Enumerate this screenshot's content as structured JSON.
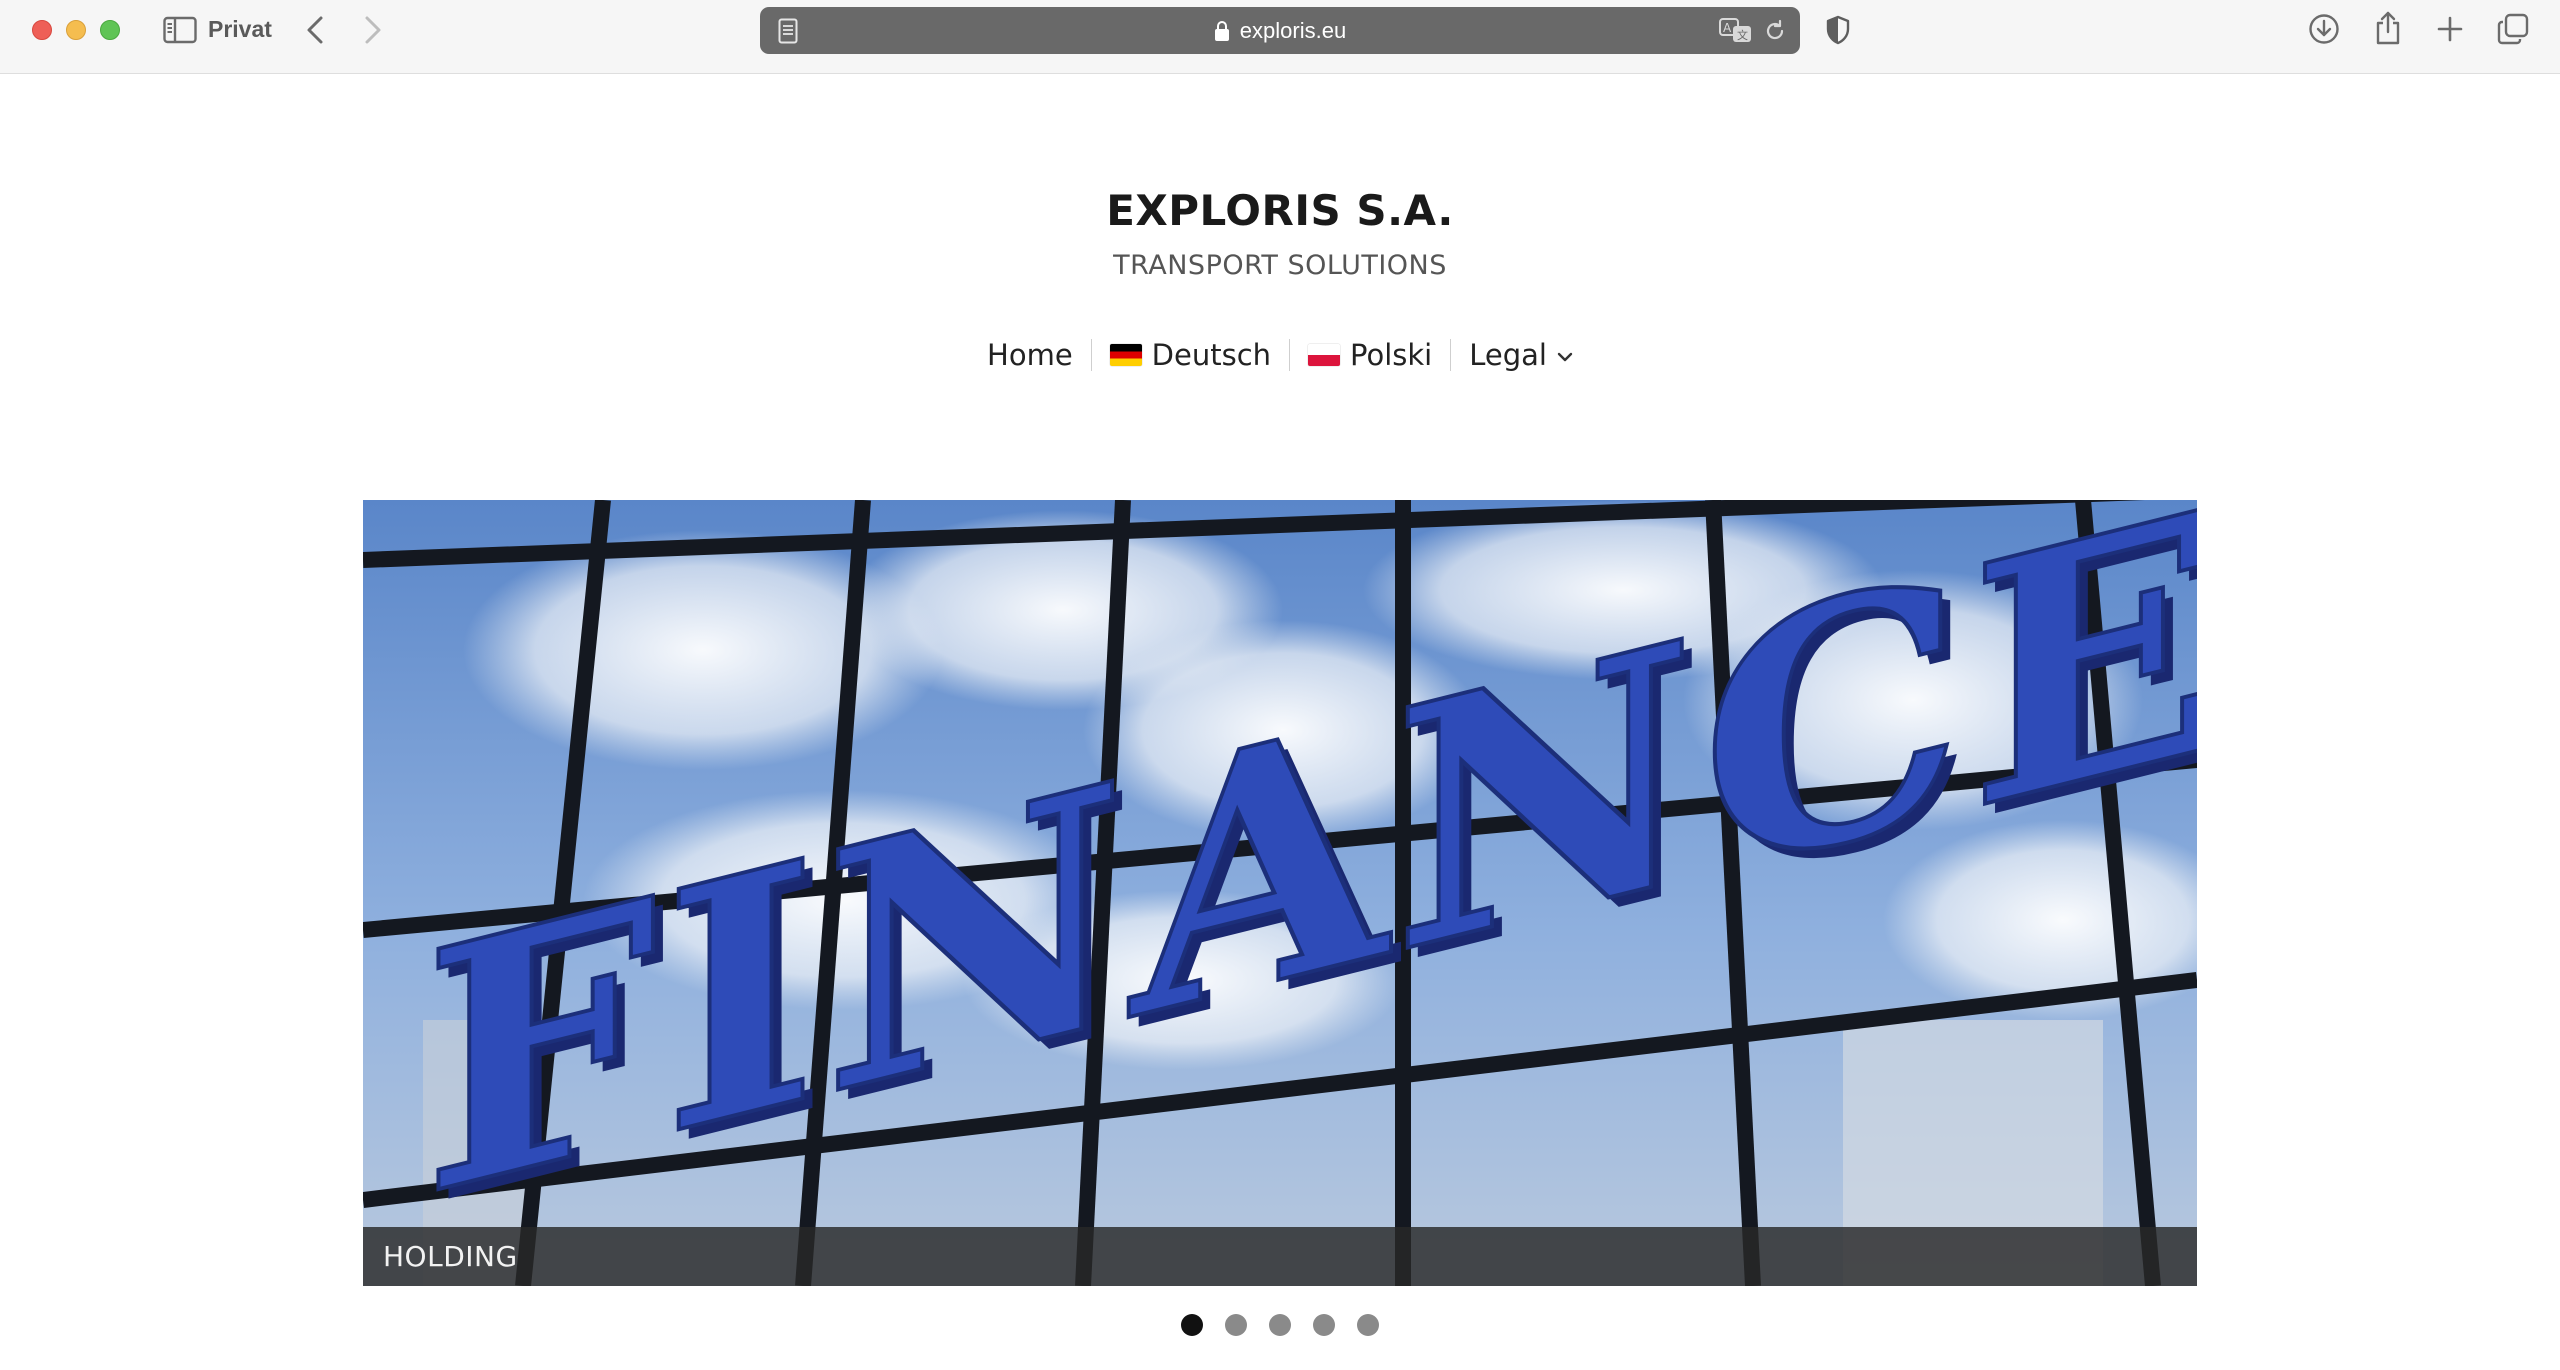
{
  "browser": {
    "window_label": "Privat",
    "url": "exploris.eu",
    "icons": [
      "sidebar-icon",
      "back-icon",
      "forward-icon",
      "reader-icon",
      "lock-icon",
      "translate-icon",
      "reload-icon",
      "shield-icon",
      "download-icon",
      "share-icon",
      "new-tab-icon",
      "tab-overview-icon"
    ]
  },
  "site": {
    "title": "EXPLORIS S.A.",
    "tagline": "TRANSPORT SOLUTIONS"
  },
  "nav": {
    "items": [
      {
        "label": "Home"
      },
      {
        "label": "Deutsch",
        "flag": "de"
      },
      {
        "label": "Polski",
        "flag": "pl"
      },
      {
        "label": "Legal",
        "dropdown": true
      }
    ]
  },
  "slider": {
    "image_text": "FINANCE",
    "caption": "HOLDING",
    "slide_count": 5,
    "active_index": 0
  }
}
